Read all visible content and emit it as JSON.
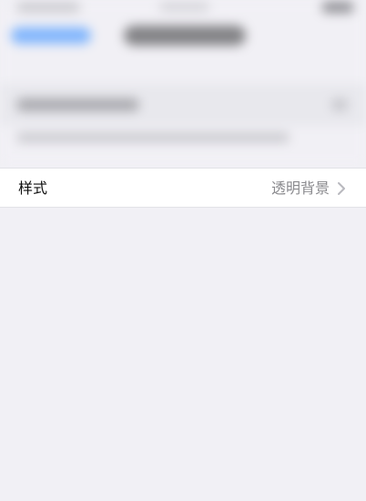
{
  "settings": {
    "style_row": {
      "label": "样式",
      "value": "透明背景",
      "icon": "chevron-right-icon"
    }
  },
  "colors": {
    "background": "#f1f0f5",
    "row_background": "#ffffff",
    "label_text": "#111111",
    "value_text": "#8a8a8e",
    "accent": "#5aa2ff"
  }
}
